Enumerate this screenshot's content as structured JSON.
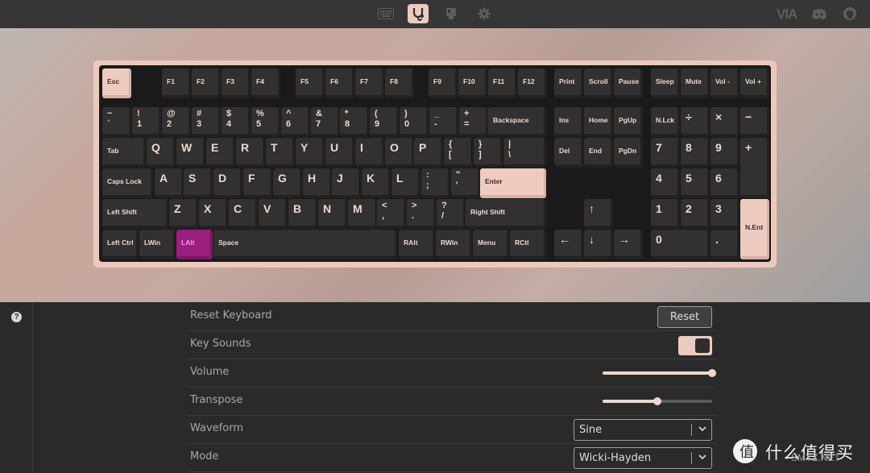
{
  "topbar": {
    "icons": [
      "keyboard-icon",
      "test-icon",
      "design-icon",
      "settings-icon"
    ],
    "active_icon": "test-icon",
    "brand": "VIA",
    "right_icons": [
      "discord-icon",
      "github-icon"
    ]
  },
  "keyboard": {
    "accent_color": "#edcbbf",
    "pressed_color": "#9a1f7f",
    "keys": [
      {
        "id": "esc",
        "l1": "Esc",
        "style": "accent"
      },
      {
        "id": "f1",
        "l1": "F1"
      },
      {
        "id": "f2",
        "l1": "F2"
      },
      {
        "id": "f3",
        "l1": "F3"
      },
      {
        "id": "f4",
        "l1": "F4"
      },
      {
        "id": "f5",
        "l1": "F5"
      },
      {
        "id": "f6",
        "l1": "F6"
      },
      {
        "id": "f7",
        "l1": "F7"
      },
      {
        "id": "f8",
        "l1": "F8"
      },
      {
        "id": "f9",
        "l1": "F9"
      },
      {
        "id": "f10",
        "l1": "F10"
      },
      {
        "id": "f11",
        "l1": "F11"
      },
      {
        "id": "f12",
        "l1": "F12"
      },
      {
        "id": "print",
        "l1": "Print"
      },
      {
        "id": "scroll",
        "l1": "Scroll"
      },
      {
        "id": "pause",
        "l1": "Pause"
      },
      {
        "id": "sleep",
        "l1": "Sleep"
      },
      {
        "id": "mute",
        "l1": "Mute"
      },
      {
        "id": "voldown",
        "l1": "Vol -"
      },
      {
        "id": "volup",
        "l1": "Vol +"
      },
      {
        "id": "grave",
        "l1": "~",
        "l2": "`"
      },
      {
        "id": "n1",
        "l1": "!",
        "l2": "1"
      },
      {
        "id": "n2",
        "l1": "@",
        "l2": "2"
      },
      {
        "id": "n3",
        "l1": "#",
        "l2": "3"
      },
      {
        "id": "n4",
        "l1": "$",
        "l2": "4"
      },
      {
        "id": "n5",
        "l1": "%",
        "l2": "5"
      },
      {
        "id": "n6",
        "l1": "^",
        "l2": "6"
      },
      {
        "id": "n7",
        "l1": "&",
        "l2": "7"
      },
      {
        "id": "n8",
        "l1": "*",
        "l2": "8"
      },
      {
        "id": "n9",
        "l1": "(",
        "l2": "9"
      },
      {
        "id": "n0",
        "l1": ")",
        "l2": "0"
      },
      {
        "id": "minus",
        "l1": "_",
        "l2": "-"
      },
      {
        "id": "equal",
        "l1": "+",
        "l2": "="
      },
      {
        "id": "backspace",
        "l1": "Backspace"
      },
      {
        "id": "ins",
        "l1": "Ins"
      },
      {
        "id": "home",
        "l1": "Home"
      },
      {
        "id": "pgup",
        "l1": "PgUp"
      },
      {
        "id": "numlock",
        "l1": "N.Lck"
      },
      {
        "id": "kpdiv",
        "l1": "÷"
      },
      {
        "id": "kpmul",
        "l1": "×"
      },
      {
        "id": "kpminus",
        "l1": "−"
      },
      {
        "id": "tab",
        "l1": "Tab"
      },
      {
        "id": "q",
        "l1": "Q"
      },
      {
        "id": "w",
        "l1": "W"
      },
      {
        "id": "e",
        "l1": "E"
      },
      {
        "id": "r",
        "l1": "R"
      },
      {
        "id": "t",
        "l1": "T"
      },
      {
        "id": "y",
        "l1": "Y"
      },
      {
        "id": "u",
        "l1": "U"
      },
      {
        "id": "i",
        "l1": "I"
      },
      {
        "id": "o",
        "l1": "O"
      },
      {
        "id": "p",
        "l1": "P"
      },
      {
        "id": "lbracket",
        "l1": "{",
        "l2": "["
      },
      {
        "id": "rbracket",
        "l1": "}",
        "l2": "]"
      },
      {
        "id": "backslash",
        "l1": "|",
        "l2": "\\"
      },
      {
        "id": "del",
        "l1": "Del"
      },
      {
        "id": "end",
        "l1": "End"
      },
      {
        "id": "pgdn",
        "l1": "PgDn"
      },
      {
        "id": "kp7",
        "l1": "7"
      },
      {
        "id": "kp8",
        "l1": "8"
      },
      {
        "id": "kp9",
        "l1": "9"
      },
      {
        "id": "kpplus",
        "l1": "+"
      },
      {
        "id": "caps",
        "l1": "Caps Lock"
      },
      {
        "id": "a",
        "l1": "A"
      },
      {
        "id": "s",
        "l1": "S"
      },
      {
        "id": "d",
        "l1": "D"
      },
      {
        "id": "f",
        "l1": "F"
      },
      {
        "id": "g",
        "l1": "G"
      },
      {
        "id": "h",
        "l1": "H"
      },
      {
        "id": "j",
        "l1": "J"
      },
      {
        "id": "k",
        "l1": "K"
      },
      {
        "id": "l",
        "l1": "L"
      },
      {
        "id": "semicolon",
        "l1": ":",
        "l2": ";"
      },
      {
        "id": "quote",
        "l1": "\"",
        "l2": "'"
      },
      {
        "id": "enter",
        "l1": "Enter",
        "style": "accent"
      },
      {
        "id": "kp4",
        "l1": "4"
      },
      {
        "id": "kp5",
        "l1": "5"
      },
      {
        "id": "kp6",
        "l1": "6"
      },
      {
        "id": "lshift",
        "l1": "Left Shift"
      },
      {
        "id": "z",
        "l1": "Z"
      },
      {
        "id": "x",
        "l1": "X"
      },
      {
        "id": "c",
        "l1": "C"
      },
      {
        "id": "v",
        "l1": "V"
      },
      {
        "id": "b",
        "l1": "B"
      },
      {
        "id": "n",
        "l1": "N"
      },
      {
        "id": "m",
        "l1": "M"
      },
      {
        "id": "comma",
        "l1": "<",
        "l2": ","
      },
      {
        "id": "period",
        "l1": ">",
        "l2": "."
      },
      {
        "id": "slash",
        "l1": "?",
        "l2": "/"
      },
      {
        "id": "rshift",
        "l1": "Right Shift"
      },
      {
        "id": "up",
        "l1": "↑"
      },
      {
        "id": "kp1",
        "l1": "1"
      },
      {
        "id": "kp2",
        "l1": "2"
      },
      {
        "id": "kp3",
        "l1": "3"
      },
      {
        "id": "kpenter",
        "l1": "N.Ent",
        "style": "accent"
      },
      {
        "id": "lctrl",
        "l1": "Left Ctrl"
      },
      {
        "id": "lwin",
        "l1": "LWin"
      },
      {
        "id": "lalt",
        "l1": "LAlt",
        "style": "purple"
      },
      {
        "id": "space",
        "l1": "Space"
      },
      {
        "id": "ralt",
        "l1": "RAlt"
      },
      {
        "id": "rwin",
        "l1": "RWin"
      },
      {
        "id": "menu",
        "l1": "Menu"
      },
      {
        "id": "rctl",
        "l1": "RCtl"
      },
      {
        "id": "left",
        "l1": "←"
      },
      {
        "id": "down",
        "l1": "↓"
      },
      {
        "id": "right",
        "l1": "→"
      },
      {
        "id": "kp0",
        "l1": "0"
      },
      {
        "id": "kpdot",
        "l1": "."
      }
    ]
  },
  "settings": {
    "help_icon": "question-circle-icon",
    "reset_keyboard": {
      "label": "Reset Keyboard",
      "button": "Reset"
    },
    "key_sounds": {
      "label": "Key Sounds",
      "on": true
    },
    "volume": {
      "label": "Volume",
      "value": 1.0
    },
    "transpose": {
      "label": "Transpose",
      "value": 0.5
    },
    "waveform": {
      "label": "Waveform",
      "selected": "Sine"
    },
    "mode": {
      "label": "Mode",
      "selected": "Wicki-Hayden"
    }
  },
  "watermark": {
    "text": "什么值得买",
    "url": "SMYZ.NET"
  }
}
